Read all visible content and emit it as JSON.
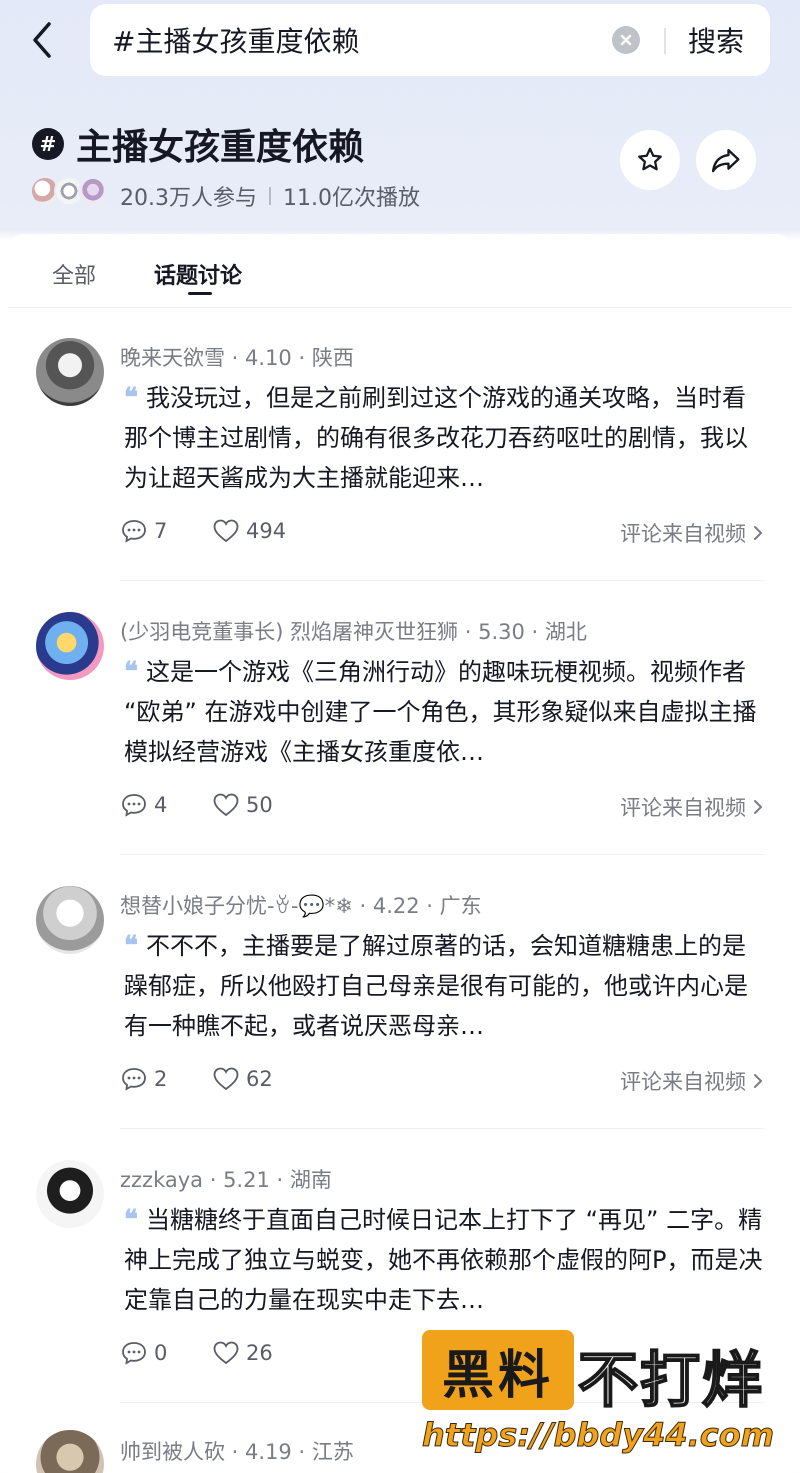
{
  "search": {
    "query": "#主播女孩重度依赖",
    "button_label": "搜索"
  },
  "topic": {
    "title": "主播女孩重度依赖",
    "participants": "20.3万人参与",
    "plays": "11.0亿次播放"
  },
  "tabs": [
    {
      "label": "全部"
    },
    {
      "label": "话题讨论"
    }
  ],
  "posts": [
    {
      "user": "晚来天欲雪",
      "date": "4.10",
      "region": "陕西",
      "text": "我没玩过，但是之前刷到过这个游戏的通关攻略，当时看那个博主过剧情，的确有很多改花刀吞药呕吐的剧情，我以为让超天酱成为大主播就能迎来…",
      "comments": "7",
      "likes": "494",
      "source": "评论来自视频"
    },
    {
      "user": "(少羽电竞董事长) 烈焰屠神灭世狂狮",
      "date": "5.30",
      "region": "湖北",
      "text": "这是一个游戏《三角洲行动》的趣味玩梗视频。视频作者 “欧弟” 在游戏中创建了一个角色，其形象疑似来自虚拟主播模拟经营游戏《主播女孩重度依…",
      "comments": "4",
      "likes": "50",
      "source": "评论来自视频"
    },
    {
      "user": "想替小娘子分忧-ꈊ-💬*❄",
      "date": "4.22",
      "region": "广东",
      "text": "不不不，主播要是了解过原著的话，会知道糖糖患上的是躁郁症，所以他殴打自己母亲是很有可能的，他或许内心是有一种瞧不起，或者说厌恶母亲…",
      "comments": "2",
      "likes": "62",
      "source": "评论来自视频"
    },
    {
      "user": "zzzkaya",
      "date": "5.21",
      "region": "湖南",
      "text": "当糖糖终于直面自己时候日记本上打下了 “再见” 二字。精神上完成了独立与蜕变，她不再依赖那个虚假的阿P，而是决定靠自己的力量在现实中走下去…",
      "comments": "0",
      "likes": "26",
      "source": ""
    },
    {
      "user": "帅到被人砍",
      "date": "4.19",
      "region": "江苏",
      "text": "",
      "comments": "",
      "likes": "",
      "source": ""
    }
  ],
  "watermark": {
    "box": "黑料",
    "text": "不打烊",
    "url": "https://bbdy44.com"
  },
  "colors": {
    "accent_quote": "#a7c4ee",
    "header_bg": "#e3e9f8",
    "watermark": "#f0a21a"
  }
}
